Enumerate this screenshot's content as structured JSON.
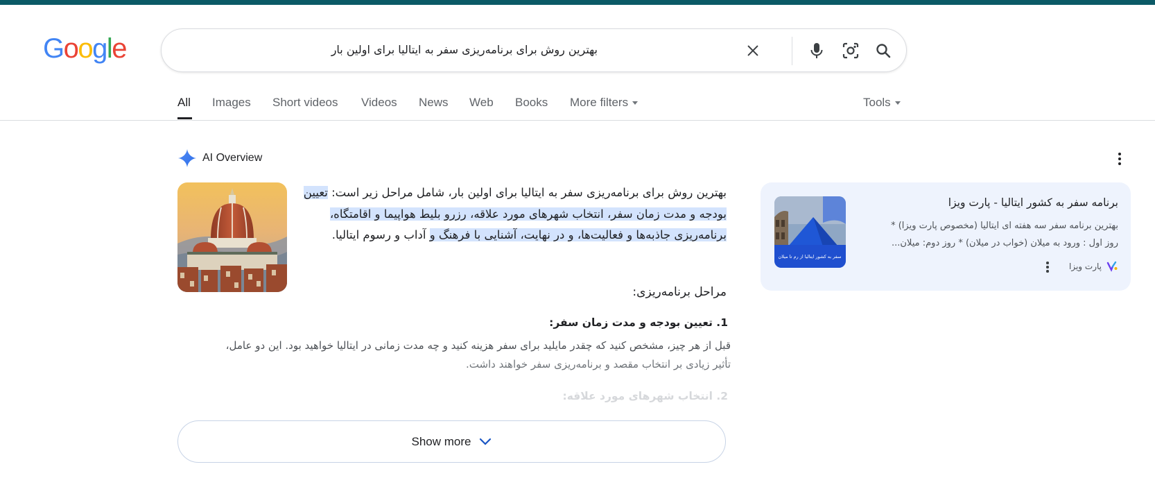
{
  "colors": {
    "topbar": "#0b5a66",
    "highlight": "#d3e3fd",
    "side_card_bg": "#eef3fd",
    "google_blue": "#4285F4",
    "google_red": "#EA4335",
    "google_yellow": "#FBBC05",
    "google_green": "#34A853"
  },
  "logo": {
    "letters": [
      "G",
      "o",
      "o",
      "g",
      "l",
      "e"
    ]
  },
  "search": {
    "query": "بهترین روش برای برنامه‌ریزی سفر به ایتالیا برای اولین بار",
    "icons": [
      "clear-icon",
      "microphone-icon",
      "camera-lens-icon",
      "search-icon"
    ]
  },
  "tabs": {
    "items": [
      "All",
      "Images",
      "Short videos",
      "Videos",
      "News",
      "Web",
      "Books",
      "More filters"
    ],
    "active": "All",
    "tools": "Tools"
  },
  "ai_overview": {
    "label": "AI Overview",
    "intro_plain": "بهترین روش برای برنامه‌ریزی سفر به ایتالیا برای اولین بار، شامل مراحل زیر است: ",
    "intro_highlight": "تعیین بودجه و مدت زمان سفر، انتخاب شهرهای مورد علاقه، رزرو بلیط هواپیما و اقامتگاه، برنامه‌ریزی جاذبه‌ها و فعالیت‌ها، و در نهایت، آشنایی با فرهنگ و",
    "intro_tail": " آداب و رسوم ایتالیا.",
    "steps_title": "مراحل برنامه‌ریزی:",
    "step1_title": "1. تعیین بودجه و مدت زمان سفر:",
    "step1_body_line1": "قبل از هر چیز، مشخص کنید که چقدر مایلید برای سفر هزینه کنید و چه مدت زمانی در ایتالیا خواهید بود. این دو عامل،",
    "step1_body_line2": "تأثیر زیادی بر انتخاب مقصد و برنامه‌ریزی سفر خواهند داشت.",
    "step2_title": "2. انتخاب شهرهای مورد علاقه:",
    "show_more": "Show more"
  },
  "side_card": {
    "title": "برنامه سفر به کشور ایتالیا - پارت ویزا",
    "snippet_line1": "بهترین برنامه سفر سه هفته ای ایتالیا (مخصوص پارت ویزا) *",
    "snippet_line2": "روز اول : ورود به میلان (خواب در میلان) * روز دوم: میلان...",
    "source": "پارت ویزا",
    "thumb_caption": "سفر به کشور ایتالیا از رم تا میلان"
  }
}
